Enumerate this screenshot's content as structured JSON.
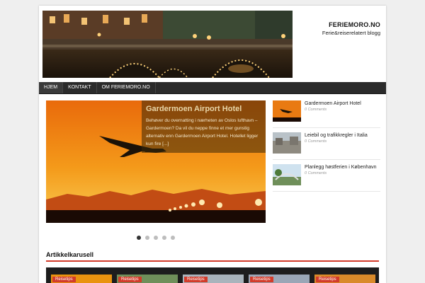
{
  "header": {
    "site_title": "FERIEMORO.NO",
    "site_description": "Ferie&reiserelatert blogg"
  },
  "nav": {
    "items": [
      "HJEM",
      "KONTAKT",
      "OM FERIEMORO.NO"
    ]
  },
  "slider": {
    "title": "Gardermoen Airport Hotel",
    "excerpt": "Behøver du overnatting i nærheten av Oslos lufthavn – Gardermoen? Da vil du neppe finne et mer gunstig alternativ enn Gardermoen Airport Hotel. Hotellet ligger kun fire [...]",
    "dot_count": 5,
    "active_dot": 1
  },
  "side_posts": [
    {
      "title": "Gardermoen Airport Hotel",
      "meta": "0 Comments"
    },
    {
      "title": "Leiebil og trafikkregler i Italia",
      "meta": "0 Comments"
    },
    {
      "title": "Planlegg høstferien i København",
      "meta": "0 Comments"
    }
  ],
  "carousel": {
    "heading": "Artikkelkarusell",
    "tag": "Reisetips"
  },
  "colors": {
    "accent": "#d23b2a",
    "nav_bg": "#2b2b2b"
  }
}
